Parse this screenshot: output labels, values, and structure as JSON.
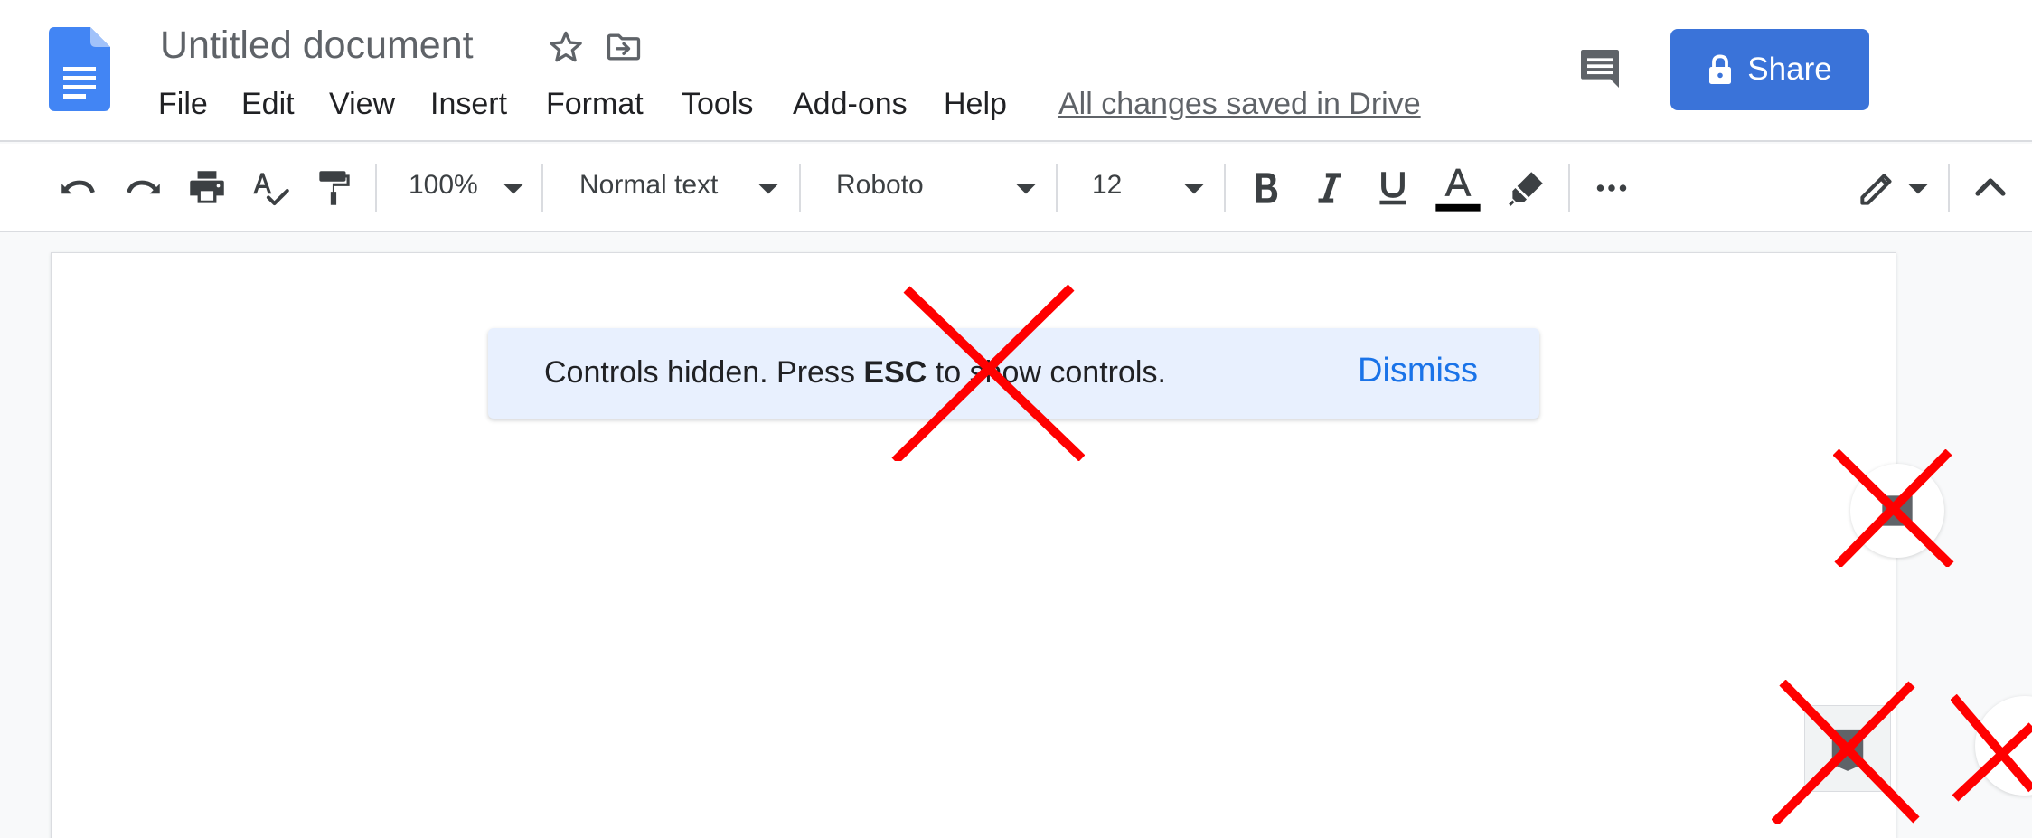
{
  "header": {
    "title": "Untitled document",
    "menu": [
      {
        "label": "File"
      },
      {
        "label": "Edit"
      },
      {
        "label": "View"
      },
      {
        "label": "Insert"
      },
      {
        "label": "Format"
      },
      {
        "label": "Tools"
      },
      {
        "label": "Add-ons"
      },
      {
        "label": "Help"
      }
    ],
    "save_status": "All changes saved in Drive",
    "share_label": "Share"
  },
  "toolbar": {
    "zoom": "100%",
    "style": "Normal text",
    "font": "Roboto",
    "size": "12",
    "text_color": "#000000"
  },
  "notice": {
    "text_before": "Controls hidden. Press ",
    "key": "ESC",
    "text_after": " to show controls.",
    "dismiss_label": "Dismiss"
  },
  "colors": {
    "accent": "#3a73d9",
    "link": "#1a73e8",
    "overlay_mark": "#ff0000"
  }
}
